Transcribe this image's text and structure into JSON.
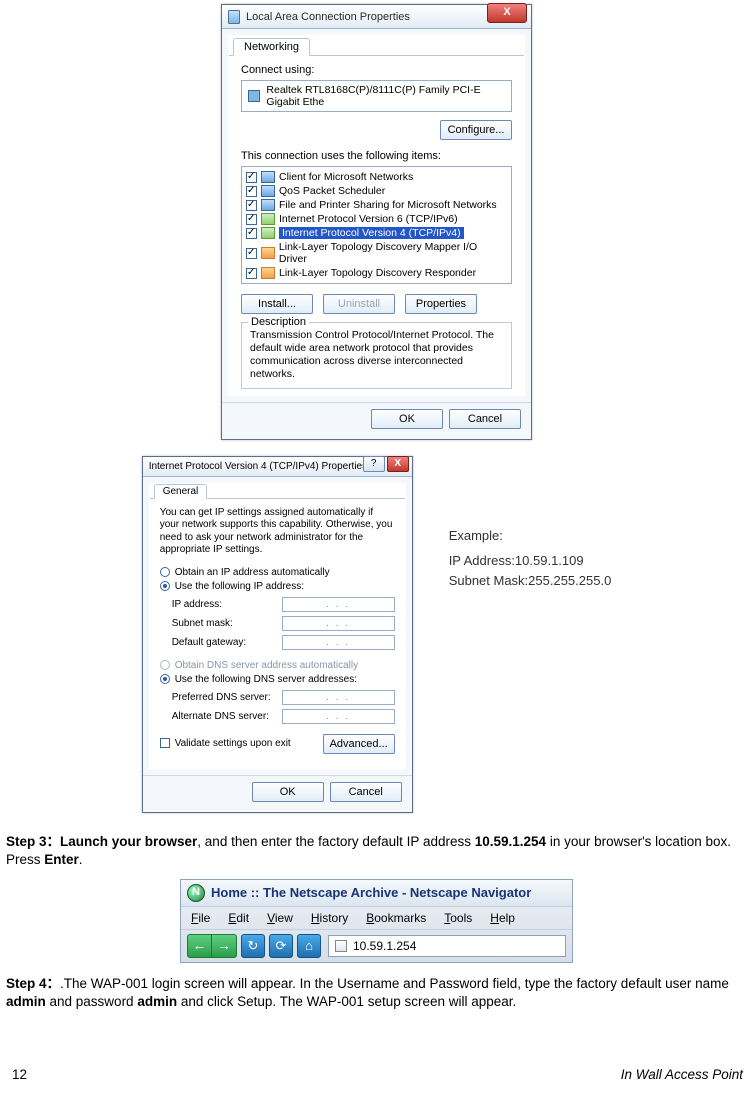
{
  "dialog1": {
    "title": "Local Area Connection Properties",
    "close": "X",
    "tab": "Networking",
    "connect_label": "Connect using:",
    "adapter": "Realtek RTL8168C(P)/8111C(P) Family PCI-E Gigabit Ethe",
    "configure": "Configure...",
    "items_label": "This connection uses the following items:",
    "items": [
      "Client for Microsoft Networks",
      "QoS Packet Scheduler",
      "File and Printer Sharing for Microsoft Networks",
      "Internet Protocol Version 6 (TCP/IPv6)",
      "Internet Protocol Version 4 (TCP/IPv4)",
      "Link-Layer Topology Discovery Mapper I/O Driver",
      "Link-Layer Topology Discovery Responder"
    ],
    "install": "Install...",
    "uninstall": "Uninstall",
    "properties": "Properties",
    "desc_title": "Description",
    "desc": "Transmission Control Protocol/Internet Protocol. The default wide area network protocol that provides communication across diverse interconnected networks.",
    "ok": "OK",
    "cancel": "Cancel"
  },
  "dialog2": {
    "title": "Internet Protocol Version 4 (TCP/IPv4) Properties",
    "help": "?",
    "close": "X",
    "tab": "General",
    "info": "You can get IP settings assigned automatically if your network supports this capability. Otherwise, you need to ask your network administrator for the appropriate IP settings.",
    "auto_ip": "Obtain an IP address automatically",
    "use_ip": "Use the following IP address:",
    "ip_label": "IP address:",
    "subnet_label": "Subnet mask:",
    "gateway_label": "Default gateway:",
    "auto_dns": "Obtain DNS server address automatically",
    "use_dns": "Use the following DNS server addresses:",
    "pref_dns": "Preferred DNS server:",
    "alt_dns": "Alternate DNS server:",
    "validate": "Validate settings upon exit",
    "advanced": "Advanced...",
    "ok": "OK",
    "cancel": "Cancel",
    "dots": ".     .     ."
  },
  "example": {
    "heading": "Example:",
    "line1": "IP Address:10.59.1.109",
    "line2": "Subnet Mask:255.255.255.0"
  },
  "step3": {
    "prefix": "Step 3：",
    "b1": "Launch your browser",
    "mid": ", and then enter the factory default IP address ",
    "b2": "10.59.1.254",
    "mid2": " in your browser's location box. Press ",
    "b3": "Enter",
    "end": "."
  },
  "browser": {
    "title": "Home :: The Netscape Archive - Netscape Navigator",
    "menus": [
      "File",
      "Edit",
      "View",
      "History",
      "Bookmarks",
      "Tools",
      "Help"
    ],
    "back": "←",
    "fwd": "→",
    "reload": "↻",
    "stop": "⟳",
    "home": "⌂",
    "address": "10.59.1.254"
  },
  "step4": {
    "prefix": "Step 4：",
    "t1": ".The WAP-001 login screen will appear. In the Username and Password field, type the factory default user name ",
    "b1": "admin",
    "t2": " and password ",
    "b2": "admin",
    "t3": " and click Setup. The WAP-001 setup screen will appear."
  },
  "footer": {
    "page": "12",
    "right": "In  Wall  Access  Point"
  }
}
